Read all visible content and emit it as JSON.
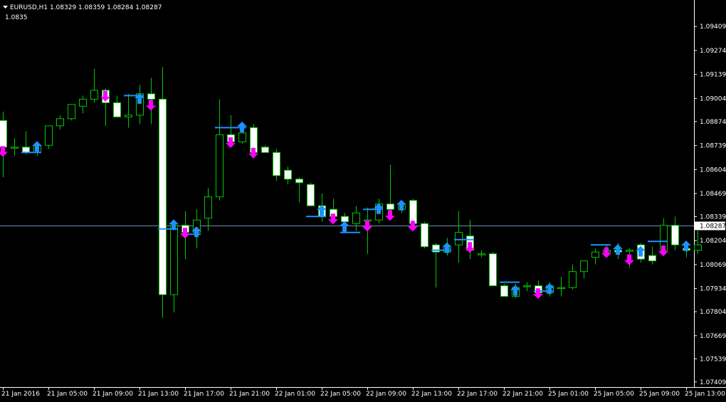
{
  "header": {
    "symbol_line": "EURUSD,H1  1.08329 1.08359 1.08284 1.08287",
    "scale_label": "1.0835"
  },
  "colors": {
    "background": "#000000",
    "frame": "#ffffff",
    "bull_wick": "#00c800",
    "bull_body": "#000000",
    "bear_body": "#ffffff",
    "current_price_line": "#6e8fb4",
    "buy_arrow": "#1e90ff",
    "sell_arrow": "#ff00ff",
    "signal_line": "#1e90ff"
  },
  "current_price": {
    "value": 1.08287,
    "label": "1.08287"
  },
  "chart_data": {
    "type": "candlestick",
    "symbol": "EURUSD",
    "timeframe": "H1",
    "ylim": [
      1.0738,
      1.0955
    ],
    "y_ticks": [
      "1.09409",
      "1.09274",
      "1.09139",
      "1.09004",
      "1.08874",
      "1.08739",
      "1.08604",
      "1.08469",
      "1.08339",
      "1.08204",
      "1.08069",
      "1.07934",
      "1.07804",
      "1.07669",
      "1.07539",
      "1.07409"
    ],
    "x_ticks": [
      {
        "label": "21 Jan 2016",
        "index": 0
      },
      {
        "label": "21 Jan 05:00",
        "index": 4
      },
      {
        "label": "21 Jan 09:00",
        "index": 8
      },
      {
        "label": "21 Jan 13:00",
        "index": 12
      },
      {
        "label": "21 Jan 17:00",
        "index": 16
      },
      {
        "label": "21 Jan 21:00",
        "index": 20
      },
      {
        "label": "22 Jan 01:00",
        "index": 24
      },
      {
        "label": "22 Jan 05:00",
        "index": 28
      },
      {
        "label": "22 Jan 09:00",
        "index": 32
      },
      {
        "label": "22 Jan 13:00",
        "index": 36
      },
      {
        "label": "22 Jan 17:00",
        "index": 40
      },
      {
        "label": "22 Jan 21:00",
        "index": 44
      },
      {
        "label": "25 Jan 01:00",
        "index": 48
      },
      {
        "label": "25 Jan 05:00",
        "index": 52
      },
      {
        "label": "25 Jan 09:00",
        "index": 56
      },
      {
        "label": "25 Jan 13:00",
        "index": 60
      }
    ],
    "candles": [
      {
        "o": 1.0888,
        "h": 1.0893,
        "l": 1.0856,
        "c": 1.0873
      },
      {
        "o": 1.0873,
        "h": 1.0878,
        "l": 1.0868,
        "c": 1.0873
      },
      {
        "o": 1.0873,
        "h": 1.0882,
        "l": 1.0869,
        "c": 1.087
      },
      {
        "o": 1.087,
        "h": 1.0875,
        "l": 1.0868,
        "c": 1.0874
      },
      {
        "o": 1.0874,
        "h": 1.0885,
        "l": 1.0872,
        "c": 1.0885
      },
      {
        "o": 1.0885,
        "h": 1.0891,
        "l": 1.0883,
        "c": 1.0889
      },
      {
        "o": 1.0889,
        "h": 1.0897,
        "l": 1.0888,
        "c": 1.0897
      },
      {
        "o": 1.0896,
        "h": 1.0902,
        "l": 1.0892,
        "c": 1.09
      },
      {
        "o": 1.09,
        "h": 1.0917,
        "l": 1.0898,
        "c": 1.0905
      },
      {
        "o": 1.0905,
        "h": 1.0906,
        "l": 1.0885,
        "c": 1.0898
      },
      {
        "o": 1.0898,
        "h": 1.0902,
        "l": 1.089,
        "c": 1.089
      },
      {
        "o": 1.089,
        "h": 1.0903,
        "l": 1.0884,
        "c": 1.0891
      },
      {
        "o": 1.0891,
        "h": 1.0908,
        "l": 1.0886,
        "c": 1.0903
      },
      {
        "o": 1.0903,
        "h": 1.0912,
        "l": 1.0886,
        "c": 1.09
      },
      {
        "o": 1.09,
        "h": 1.0918,
        "l": 1.0777,
        "c": 1.079
      },
      {
        "o": 1.079,
        "h": 1.0829,
        "l": 1.078,
        "c": 1.0829
      },
      {
        "o": 1.0829,
        "h": 1.0837,
        "l": 1.081,
        "c": 1.0825
      },
      {
        "o": 1.0825,
        "h": 1.0838,
        "l": 1.0816,
        "c": 1.0832
      },
      {
        "o": 1.0833,
        "h": 1.085,
        "l": 1.0826,
        "c": 1.0845
      },
      {
        "o": 1.0845,
        "h": 1.09,
        "l": 1.0843,
        "c": 1.088
      },
      {
        "o": 1.088,
        "h": 1.0891,
        "l": 1.0876,
        "c": 1.0876
      },
      {
        "o": 1.0876,
        "h": 1.0886,
        "l": 1.0875,
        "c": 1.0881
      },
      {
        "o": 1.0884,
        "h": 1.0886,
        "l": 1.0868,
        "c": 1.087
      },
      {
        "o": 1.0873,
        "h": 1.0874,
        "l": 1.087,
        "c": 1.087
      },
      {
        "o": 1.087,
        "h": 1.0872,
        "l": 1.0854,
        "c": 1.0857
      },
      {
        "o": 1.086,
        "h": 1.0862,
        "l": 1.0852,
        "c": 1.0855
      },
      {
        "o": 1.0855,
        "h": 1.0856,
        "l": 1.0842,
        "c": 1.0853
      },
      {
        "o": 1.0852,
        "h": 1.0853,
        "l": 1.084,
        "c": 1.084
      },
      {
        "o": 1.084,
        "h": 1.0847,
        "l": 1.0831,
        "c": 1.0834
      },
      {
        "o": 1.0838,
        "h": 1.0844,
        "l": 1.0834,
        "c": 1.0834
      },
      {
        "o": 1.0834,
        "h": 1.0836,
        "l": 1.0825,
        "c": 1.0831
      },
      {
        "o": 1.083,
        "h": 1.084,
        "l": 1.0826,
        "c": 1.0836
      },
      {
        "o": 1.0832,
        "h": 1.0839,
        "l": 1.0813,
        "c": 1.0832
      },
      {
        "o": 1.0832,
        "h": 1.0844,
        "l": 1.083,
        "c": 1.0841
      },
      {
        "o": 1.0841,
        "h": 1.0863,
        "l": 1.0834,
        "c": 1.0838
      },
      {
        "o": 1.0838,
        "h": 1.0842,
        "l": 1.0836,
        "c": 1.084
      },
      {
        "o": 1.0843,
        "h": 1.0844,
        "l": 1.0828,
        "c": 1.083
      },
      {
        "o": 1.083,
        "h": 1.0831,
        "l": 1.0816,
        "c": 1.0817
      },
      {
        "o": 1.0818,
        "h": 1.0819,
        "l": 1.0794,
        "c": 1.0814
      },
      {
        "o": 1.0814,
        "h": 1.0822,
        "l": 1.0812,
        "c": 1.0816
      },
      {
        "o": 1.0818,
        "h": 1.0837,
        "l": 1.0808,
        "c": 1.0825
      },
      {
        "o": 1.0823,
        "h": 1.0832,
        "l": 1.081,
        "c": 1.0815
      },
      {
        "o": 1.0813,
        "h": 1.0815,
        "l": 1.0811,
        "c": 1.0813
      },
      {
        "o": 1.0813,
        "h": 1.0814,
        "l": 1.0795,
        "c": 1.0795
      },
      {
        "o": 1.0795,
        "h": 1.0796,
        "l": 1.0789,
        "c": 1.0789
      },
      {
        "o": 1.0789,
        "h": 1.0796,
        "l": 1.0788,
        "c": 1.0794
      },
      {
        "o": 1.0795,
        "h": 1.0797,
        "l": 1.0792,
        "c": 1.0795
      },
      {
        "o": 1.0795,
        "h": 1.0798,
        "l": 1.0788,
        "c": 1.0791
      },
      {
        "o": 1.0791,
        "h": 1.0797,
        "l": 1.0789,
        "c": 1.0795
      },
      {
        "o": 1.0794,
        "h": 1.08,
        "l": 1.0789,
        "c": 1.0794
      },
      {
        "o": 1.0794,
        "h": 1.0807,
        "l": 1.0793,
        "c": 1.0803
      },
      {
        "o": 1.0803,
        "h": 1.0809,
        "l": 1.0799,
        "c": 1.0809
      },
      {
        "o": 1.0811,
        "h": 1.0816,
        "l": 1.0807,
        "c": 1.0814
      },
      {
        "o": 1.0814,
        "h": 1.0818,
        "l": 1.0812,
        "c": 1.0815
      },
      {
        "o": 1.0815,
        "h": 1.0819,
        "l": 1.081,
        "c": 1.0814
      },
      {
        "o": 1.0815,
        "h": 1.0816,
        "l": 1.0805,
        "c": 1.0815
      },
      {
        "o": 1.0818,
        "h": 1.0819,
        "l": 1.0808,
        "c": 1.081
      },
      {
        "o": 1.0812,
        "h": 1.0817,
        "l": 1.0807,
        "c": 1.0809
      },
      {
        "o": 1.0815,
        "h": 1.0833,
        "l": 1.0812,
        "c": 1.0829
      },
      {
        "o": 1.0829,
        "h": 1.0834,
        "l": 1.0815,
        "c": 1.0818
      },
      {
        "o": 1.0816,
        "h": 1.0818,
        "l": 1.0811,
        "c": 1.0815
      },
      {
        "o": 1.0815,
        "h": 1.0826,
        "l": 1.0813,
        "c": 1.0818
      }
    ],
    "buy_signals": [
      {
        "index": 3,
        "price": 1.087
      },
      {
        "index": 12,
        "price": 1.0897
      },
      {
        "index": 15,
        "price": 1.0826
      },
      {
        "index": 17,
        "price": 1.0822
      },
      {
        "index": 21,
        "price": 1.0881
      },
      {
        "index": 28,
        "price": 1.0834
      },
      {
        "index": 30,
        "price": 1.0825
      },
      {
        "index": 33,
        "price": 1.0835
      },
      {
        "index": 35,
        "price": 1.0837
      },
      {
        "index": 39,
        "price": 1.0813
      },
      {
        "index": 45,
        "price": 1.0789
      },
      {
        "index": 48,
        "price": 1.079
      },
      {
        "index": 54,
        "price": 1.0812
      },
      {
        "index": 56,
        "price": 1.0811
      },
      {
        "index": 60,
        "price": 1.0814
      }
    ],
    "sell_signals": [
      {
        "index": 0,
        "price": 1.0874
      },
      {
        "index": 9,
        "price": 1.0905
      },
      {
        "index": 13,
        "price": 1.09
      },
      {
        "index": 16,
        "price": 1.0828
      },
      {
        "index": 20,
        "price": 1.0879
      },
      {
        "index": 22,
        "price": 1.0873
      },
      {
        "index": 29,
        "price": 1.0836
      },
      {
        "index": 32,
        "price": 1.0832
      },
      {
        "index": 34,
        "price": 1.0838
      },
      {
        "index": 36,
        "price": 1.0832
      },
      {
        "index": 41,
        "price": 1.082
      },
      {
        "index": 47,
        "price": 1.0794
      },
      {
        "index": 53,
        "price": 1.0817
      },
      {
        "index": 55,
        "price": 1.0813
      },
      {
        "index": 58,
        "price": 1.0818
      }
    ],
    "signal_lines": [
      {
        "start": 2,
        "end": 3,
        "price": 1.087
      },
      {
        "start": 11,
        "end": 12,
        "price": 1.0902
      },
      {
        "start": 14,
        "end": 15,
        "price": 1.0827
      },
      {
        "start": 16,
        "end": 17,
        "price": 1.0824
      },
      {
        "start": 19,
        "end": 21,
        "price": 1.0884
      },
      {
        "start": 27,
        "end": 28,
        "price": 1.0834
      },
      {
        "start": 30,
        "end": 31,
        "price": 1.0825
      },
      {
        "start": 32,
        "end": 33,
        "price": 1.0838
      },
      {
        "start": 38,
        "end": 39,
        "price": 1.0815
      },
      {
        "start": 40,
        "end": 41,
        "price": 1.0821
      },
      {
        "start": 44,
        "end": 45,
        "price": 1.0797
      },
      {
        "start": 47,
        "end": 48,
        "price": 1.0792
      },
      {
        "start": 52,
        "end": 53,
        "price": 1.0818
      },
      {
        "start": 57,
        "end": 58,
        "price": 1.082
      }
    ]
  }
}
